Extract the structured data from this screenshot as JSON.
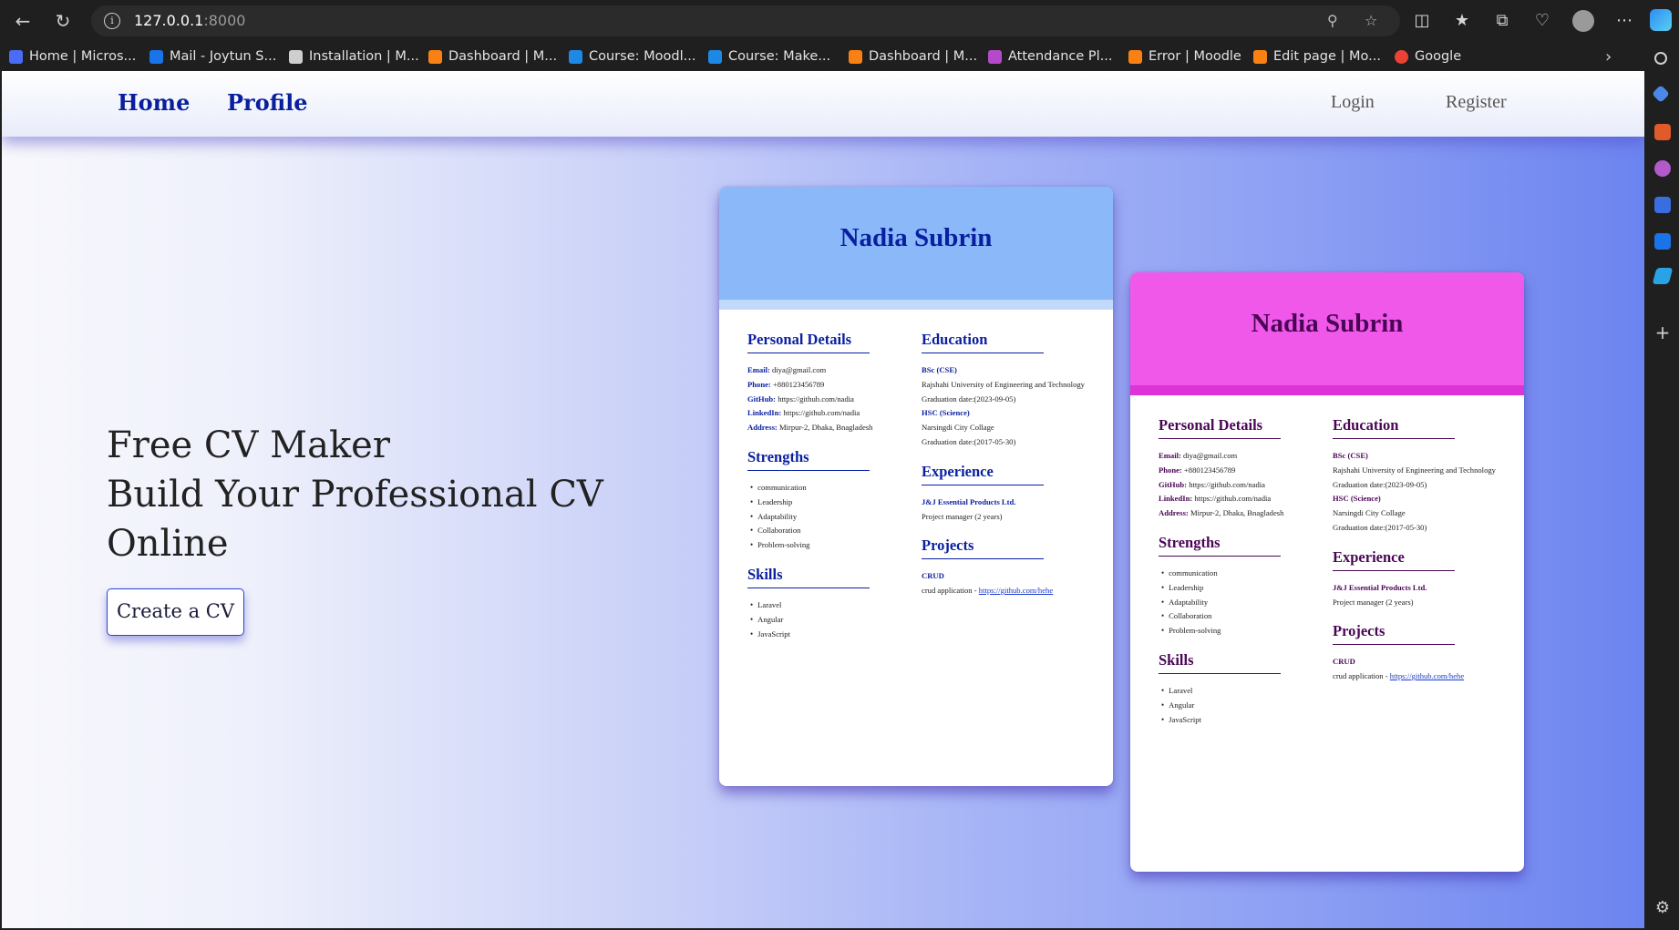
{
  "browser": {
    "url_host": "127.0.0.1",
    "url_port": ":8000",
    "bookmarks": [
      {
        "label": "Home | Micros...",
        "color": "#4a6cf7"
      },
      {
        "label": "Mail - Joytun S...",
        "color": "#1a73e8"
      },
      {
        "label": "Installation | M...",
        "color": "#cfcfcf"
      },
      {
        "label": "Dashboard | M...",
        "color": "#f98012"
      },
      {
        "label": "Course: Moodl...",
        "color": "#1e88e5"
      },
      {
        "label": "Course: Make...",
        "color": "#1e88e5"
      },
      {
        "label": "Dashboard | M...",
        "color": "#f98012"
      },
      {
        "label": "Attendance Pl...",
        "color": "#b44ac9"
      },
      {
        "label": "Error | Moodle",
        "color": "#f98012"
      },
      {
        "label": "Edit page | Mo...",
        "color": "#f98012"
      },
      {
        "label": "Google",
        "color": "#ea4335"
      }
    ]
  },
  "nav": {
    "home": "Home",
    "profile": "Profile",
    "login": "Login",
    "register": "Register"
  },
  "hero": {
    "line1": "Free CV Maker",
    "line2": "Build Your Professional CV",
    "line3": "Online",
    "cta": "Create a CV"
  },
  "cv": {
    "name": "Nadia Subrin",
    "personal_title": "Personal Details",
    "email_label": "Email:",
    "email": "diya@gmail.com",
    "phone_label": "Phone:",
    "phone": "+880123456789",
    "github_label": "GitHub:",
    "github": "https://github.com/nadia",
    "linkedin_label": "LinkedIn:",
    "linkedin": "https://github.com/nadia",
    "address_label": "Address:",
    "address": "Mirpur-2, Dhaka, Bnagladesh",
    "strengths_title": "Strengths",
    "strengths": [
      "communication",
      "Leadership",
      "Adaptability",
      "Collaboration",
      "Problem-solving"
    ],
    "skills_title": "Skills",
    "skills": [
      "Laravel",
      "Angular",
      "JavaScript"
    ],
    "education_title": "Education",
    "edu1_degree": "BSc (CSE)",
    "edu1_school": "Rajshahi University of Engineering and Technology",
    "edu1_date": "Graduation date:(2023-09-05)",
    "edu2_degree": "HSC (Science)",
    "edu2_school": "Narsingdi City Collage",
    "edu2_date": "Graduation date:(2017-05-30)",
    "experience_title": "Experience",
    "exp_company": "J&J Essential Products Ltd.",
    "exp_role": "Project manager (2 years)",
    "projects_title": "Projects",
    "proj_name": "CRUD",
    "proj_desc": "crud application - ",
    "proj_link": "https://github.com/hehe"
  },
  "colors": {
    "nav_link": "#0a1f9e",
    "cv1_header": "#8ab8f9",
    "cv2_header": "#f058ea"
  }
}
